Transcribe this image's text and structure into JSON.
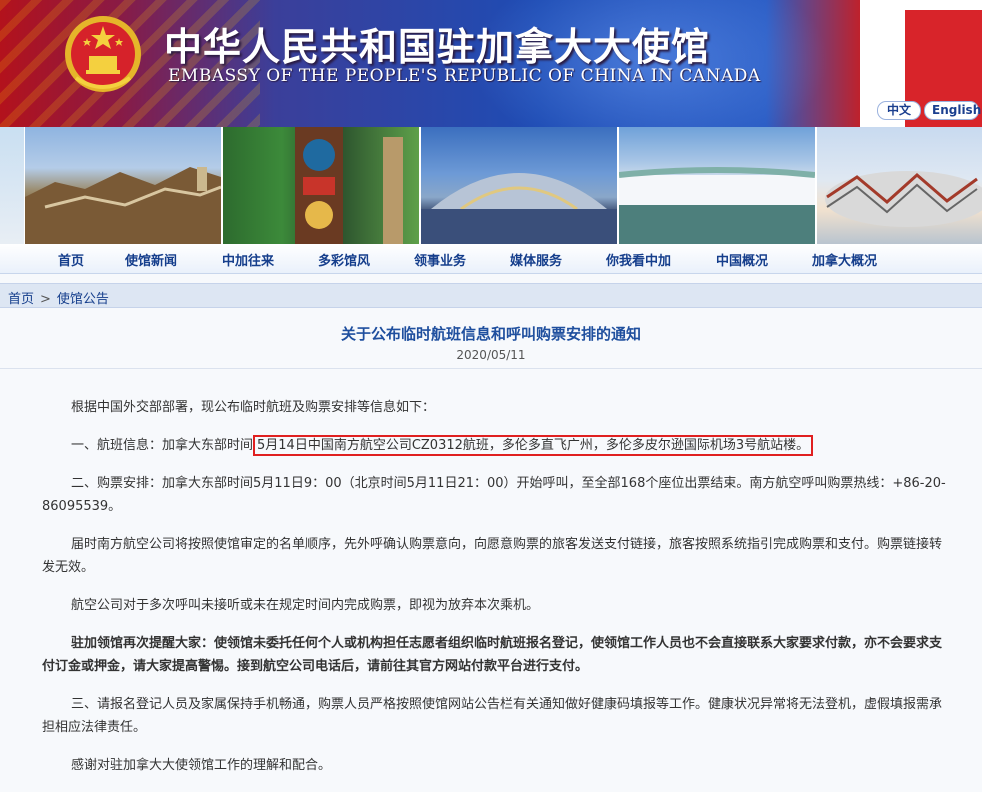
{
  "banner": {
    "title_cn": "中华人民共和国驻加拿大大使馆",
    "title_en": "EMBASSY OF THE PEOPLE'S REPUBLIC OF CHINA IN CANADA",
    "lang_cn": "中文",
    "lang_en": "English"
  },
  "nav": {
    "items": [
      "首页",
      "使馆新闻",
      "中加往来",
      "多彩馆风",
      "领事业务",
      "媒体服务",
      "你我看中加",
      "中国概况",
      "加拿大概况"
    ]
  },
  "breadcrumb": {
    "home": "首页",
    "separator": ">",
    "section": "使馆公告"
  },
  "article": {
    "title": "关于公布临时航班信息和呼叫购票安排的通知",
    "date": "2020/05/11",
    "p1": "根据中国外交部部署，现公布临时航班及购票安排等信息如下：",
    "p2_prefix": "一、航班信息：加拿大东部时间",
    "p2_highlight": "5月14日中国南方航空公司CZ0312航班，多伦多直飞广州，多伦多皮尔逊国际机场3号航站楼。",
    "p3": "二、购票安排：加拿大东部时间5月11日9：00（北京时间5月11日21：00）开始呼叫，至全部168个座位出票结束。南方航空呼叫购票热线：+86-20-86095539。",
    "p4": "届时南方航空公司将按照使馆审定的名单顺序，先外呼确认购票意向，向愿意购票的旅客发送支付链接，旅客按照系统指引完成购票和支付。购票链接转发无效。",
    "p5": "航空公司对于多次呼叫未接听或未在规定时间内完成购票，即视为放弃本次乘机。",
    "p6": "驻加领馆再次提醒大家：使领馆未委托任何个人或机构担任志愿者组织临时航班报名登记，使领馆工作人员也不会直接联系大家要求付款，亦不会要求支付订金或押金，请大家提高警惕。接到航空公司电话后，请前往其官方网站付款平台进行支付。",
    "p7": "三、请报名登记人员及家属保持手机畅通，购票人员严格按照使馆网站公告栏有关通知做好健康码填报等工作。健康状况异常将无法登机，虚假填报需承担相应法律责任。",
    "p8": "感谢对驻加拿大大使领馆工作的理解和配合。"
  },
  "colors": {
    "nav_text": "#153e8c",
    "title_blue": "#1f4f9e",
    "highlight_border": "#e02020"
  },
  "icons": {
    "emblem": "national-emblem-icon"
  }
}
